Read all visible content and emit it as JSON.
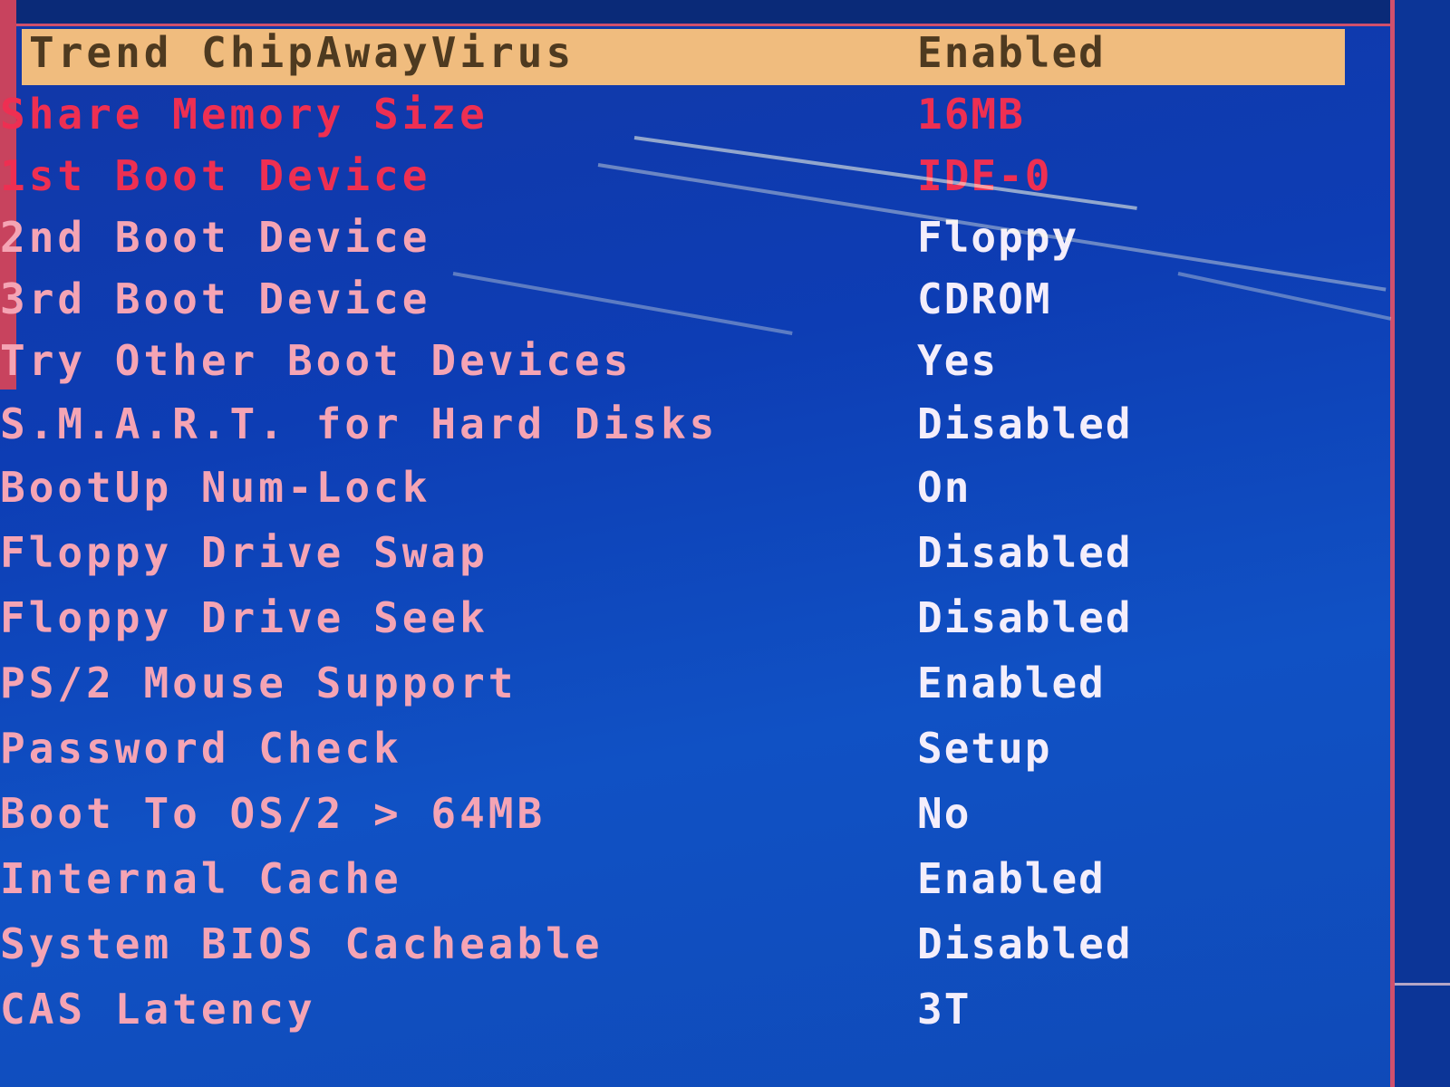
{
  "bios": {
    "settings": [
      {
        "label": "Trend ChipAwayVirus",
        "value": "Enabled"
      },
      {
        "label": "Share Memory Size",
        "value": "16MB"
      },
      {
        "label": "1st Boot Device",
        "value": "IDE-0"
      },
      {
        "label": "2nd Boot Device",
        "value": "Floppy"
      },
      {
        "label": "3rd Boot Device",
        "value": "CDROM"
      },
      {
        "label": "Try Other Boot Devices",
        "value": "Yes"
      },
      {
        "label": "S.M.A.R.T. for Hard Disks",
        "value": "Disabled"
      },
      {
        "label": "BootUp Num-Lock",
        "value": "On"
      },
      {
        "label": "Floppy Drive Swap",
        "value": "Disabled"
      },
      {
        "label": "Floppy Drive Seek",
        "value": "Disabled"
      },
      {
        "label": "PS/2 Mouse Support",
        "value": "Enabled"
      },
      {
        "label": "Password Check",
        "value": "Setup"
      },
      {
        "label": "Boot To OS/2 > 64MB",
        "value": "No"
      },
      {
        "label": "Internal Cache",
        "value": "Enabled"
      },
      {
        "label": "System BIOS Cacheable",
        "value": "Disabled"
      },
      {
        "label": "CAS Latency",
        "value": "3T"
      }
    ]
  },
  "colors": {
    "background": "#0d3db4",
    "label_text": "#f5a4b4",
    "value_text": "#f4eefb",
    "highlight_bar": "#f0bc7e",
    "highlight_text": "#4e3a20",
    "frame_line": "#d0506c"
  }
}
